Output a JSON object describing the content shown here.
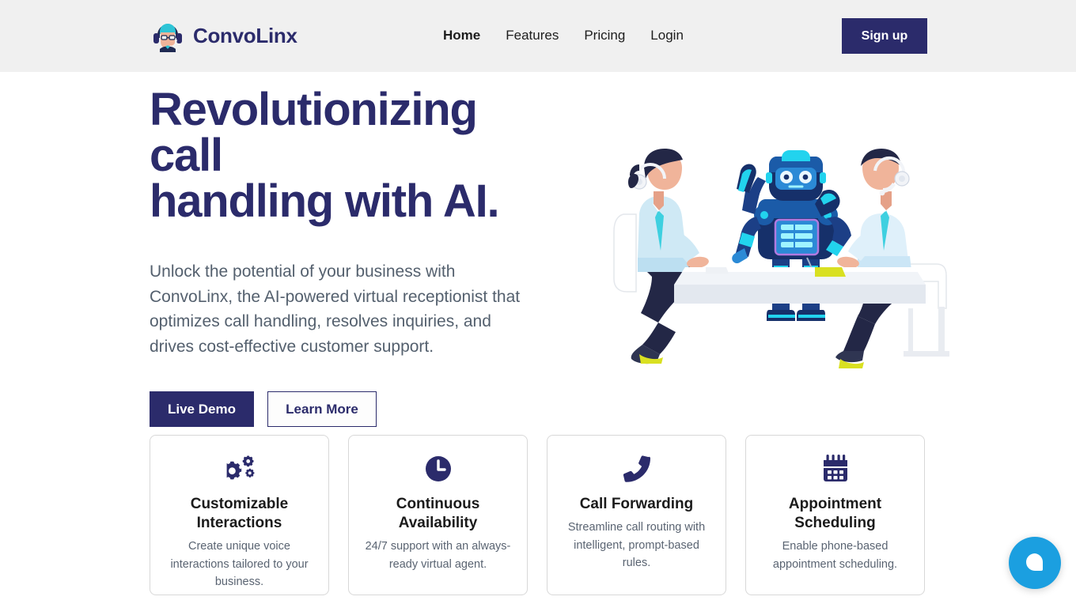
{
  "header": {
    "brand": {
      "name": "ConvoLinx",
      "logo_icon": "headset-avatar-icon"
    },
    "nav": [
      {
        "label": "Home",
        "active": true
      },
      {
        "label": "Features",
        "active": false
      },
      {
        "label": "Pricing",
        "active": false
      },
      {
        "label": "Login",
        "active": false
      }
    ],
    "signup_label": "Sign up",
    "background_color": "#f0f0f0"
  },
  "hero": {
    "title_line1": "Revolutionizing call",
    "title_line2": "handling with AI.",
    "subtitle": "Unlock the potential of your business with ConvoLinx, the AI-powered virtual receptionist that optimizes call handling, resolves inquiries, and drives cost-effective customer support.",
    "primary_cta": "Live Demo",
    "secondary_cta": "Learn More",
    "illustration": "ai-robot-call-center-meeting-illustration"
  },
  "features": [
    {
      "icon": "gears-icon",
      "title": "Customizable Interactions",
      "desc": "Create unique voice interactions tailored to your business."
    },
    {
      "icon": "clock-icon",
      "title": "Continuous Availability",
      "desc": "24/7 support with an always-ready virtual agent."
    },
    {
      "icon": "phone-icon",
      "title": "Call Forwarding",
      "desc": "Streamline call routing with intelligent, prompt-based rules."
    },
    {
      "icon": "calendar-icon",
      "title": "Appointment Scheduling",
      "desc": "Enable phone-based appointment scheduling."
    }
  ],
  "chat_widget": {
    "icon": "chat-bubble-icon",
    "color": "#1b9fe0"
  },
  "colors": {
    "navy": "#2b2b6b",
    "header_bg": "#f0f0f0",
    "body_text": "#54606e",
    "card_border": "#d8d8d8",
    "accent_blue": "#1b9fe0"
  }
}
